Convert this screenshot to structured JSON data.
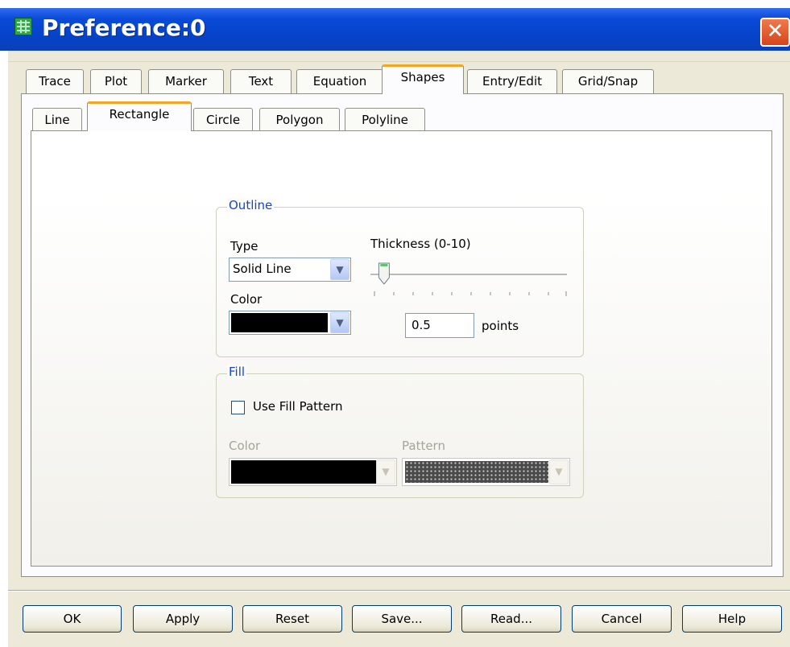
{
  "window": {
    "title": "Preference:0",
    "close_glyph": "✕"
  },
  "tabs": [
    "Trace",
    "Plot",
    "Marker",
    "Text",
    "Equation",
    "Shapes",
    "Entry/Edit",
    "Grid/Snap"
  ],
  "selected_tab": "Shapes",
  "subtabs": [
    "Line",
    "Rectangle",
    "Circle",
    "Polygon",
    "Polyline"
  ],
  "selected_subtab": "Rectangle",
  "outline": {
    "legend": "Outline",
    "type_label": "Type",
    "type_value": "Solid Line",
    "color_label": "Color",
    "color_value": "#000000",
    "thickness_label": "Thickness (0-10)",
    "thickness_value": "0.5",
    "thickness_fraction": 0.05,
    "units_label": "points"
  },
  "fill": {
    "legend": "Fill",
    "checkbox_label": "Use Fill Pattern",
    "checked": false,
    "color_label": "Color",
    "pattern_label": "Pattern",
    "color_value": "#000000"
  },
  "buttons": [
    "OK",
    "Apply",
    "Reset",
    "Save...",
    "Read...",
    "Cancel",
    "Help"
  ],
  "icons": {
    "dropdown": "chevron-down-icon",
    "app": "grid-app-icon",
    "close": "close-icon"
  },
  "colors": {
    "titlebar": "#0a4ad8",
    "selected_tab_accent": "#f3a524",
    "group_legend": "#1645d6"
  }
}
